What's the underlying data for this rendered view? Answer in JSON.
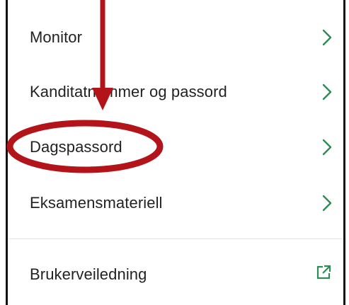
{
  "menu": {
    "items": [
      {
        "label": "Monitor",
        "icon": "chevron-right-icon"
      },
      {
        "label": "Kanditatnummer og passord",
        "icon": "chevron-right-icon"
      },
      {
        "label": "Dagspassord",
        "icon": "chevron-right-icon",
        "highlighted": true
      },
      {
        "label": "Eksamensmateriell",
        "icon": "chevron-right-icon"
      }
    ],
    "footer_item": {
      "label": "Brukerveiledning",
      "icon": "external-link-icon"
    }
  },
  "colors": {
    "text": "#222222",
    "icon_accent": "#2e8b57",
    "annotation_red": "#b3141a",
    "frame": "#111111",
    "divider": "#e3e3e3"
  },
  "annotation": {
    "arrow_icon": "down-arrow-annotation",
    "ellipse_icon": "highlight-ellipse-annotation",
    "target": "Dagspassord"
  }
}
